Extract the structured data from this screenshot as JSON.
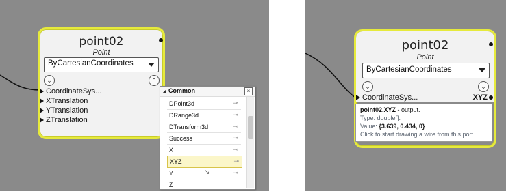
{
  "left": {
    "node": {
      "title": "point02",
      "subtitle": "Point",
      "method": "ByCartesianCoordinates",
      "ports": [
        "CoordinateSys...",
        "XTranslation",
        "YTranslation",
        "ZTranslation"
      ],
      "expand_icon": "chevron-down-icon",
      "collapse_icon": "chevron-up-icon"
    },
    "popup": {
      "section": "Common",
      "items": [
        {
          "label": "DPoint3d"
        },
        {
          "label": "DRange3d"
        },
        {
          "label": "DTransform3d"
        },
        {
          "label": "Success"
        },
        {
          "label": "X"
        },
        {
          "label": "XYZ",
          "selected": true
        },
        {
          "label": "Y"
        },
        {
          "label": "Z"
        }
      ],
      "close_label": "×"
    }
  },
  "right": {
    "node": {
      "title": "point02",
      "subtitle": "Point",
      "method": "ByCartesianCoordinates",
      "port_left": "CoordinateSys...",
      "port_right": "XYZ"
    },
    "tooltip": {
      "name": "point02.XYZ",
      "kind": " - output.",
      "type_line": "Type: double[].",
      "value_prefix": "Value: ",
      "value": "{3.639, 0.434, 0}",
      "hint": "Click to start drawing a wire from this port."
    }
  },
  "colors": {
    "canvas": "#8a8a8a",
    "node_border": "#e6ea3c",
    "highlight": "#b9d7ee"
  }
}
